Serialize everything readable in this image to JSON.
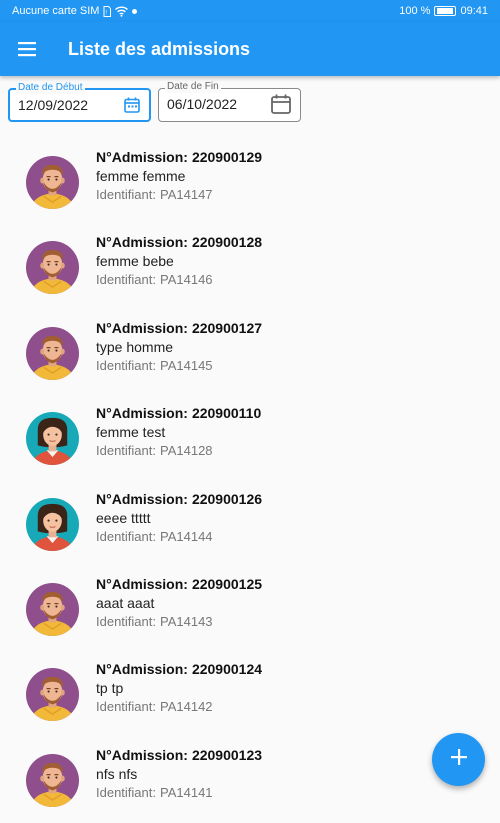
{
  "status_bar": {
    "carrier": "Aucune carte SIM",
    "battery_level": "100 %",
    "time": "09:41"
  },
  "app_bar": {
    "title": "Liste des admissions",
    "menu_icon": "hamburger-menu-icon"
  },
  "filters": {
    "start": {
      "label": "Date de Début",
      "value": "12/09/2022",
      "icon": "calendar-icon"
    },
    "end": {
      "label": "Date de Fin",
      "value": "06/10/2022",
      "icon": "calendar-icon"
    }
  },
  "colors": {
    "primary": "#2196f3",
    "avatar_male_bg": "#8e4f8c",
    "avatar_female_bg": "#17a9b8"
  },
  "admissions": [
    {
      "admission_label": "N°Admission:",
      "admission_number": "220900129",
      "name": "femme femme",
      "id_label": "Identifiant:",
      "identifier": "PA14147",
      "avatar": "male-avatar"
    },
    {
      "admission_label": "N°Admission:",
      "admission_number": "220900128",
      "name": "femme bebe",
      "id_label": "Identifiant:",
      "identifier": "PA14146",
      "avatar": "male-avatar"
    },
    {
      "admission_label": "N°Admission:",
      "admission_number": "220900127",
      "name": "type homme",
      "id_label": "Identifiant:",
      "identifier": "PA14145",
      "avatar": "male-avatar"
    },
    {
      "admission_label": "N°Admission:",
      "admission_number": "220900110",
      "name": "femme test",
      "id_label": "Identifiant:",
      "identifier": "PA14128",
      "avatar": "female-avatar"
    },
    {
      "admission_label": "N°Admission:",
      "admission_number": "220900126",
      "name": "eeee ttttt",
      "id_label": "Identifiant:",
      "identifier": "PA14144",
      "avatar": "female-avatar"
    },
    {
      "admission_label": "N°Admission:",
      "admission_number": "220900125",
      "name": "aaat aaat",
      "id_label": "Identifiant:",
      "identifier": "PA14143",
      "avatar": "male-avatar"
    },
    {
      "admission_label": "N°Admission:",
      "admission_number": "220900124",
      "name": "tp tp",
      "id_label": "Identifiant:",
      "identifier": "PA14142",
      "avatar": "male-avatar"
    },
    {
      "admission_label": "N°Admission:",
      "admission_number": "220900123",
      "name": "nfs nfs",
      "id_label": "Identifiant:",
      "identifier": "PA14141",
      "avatar": "male-avatar"
    }
  ],
  "fab": {
    "icon": "plus-icon"
  }
}
